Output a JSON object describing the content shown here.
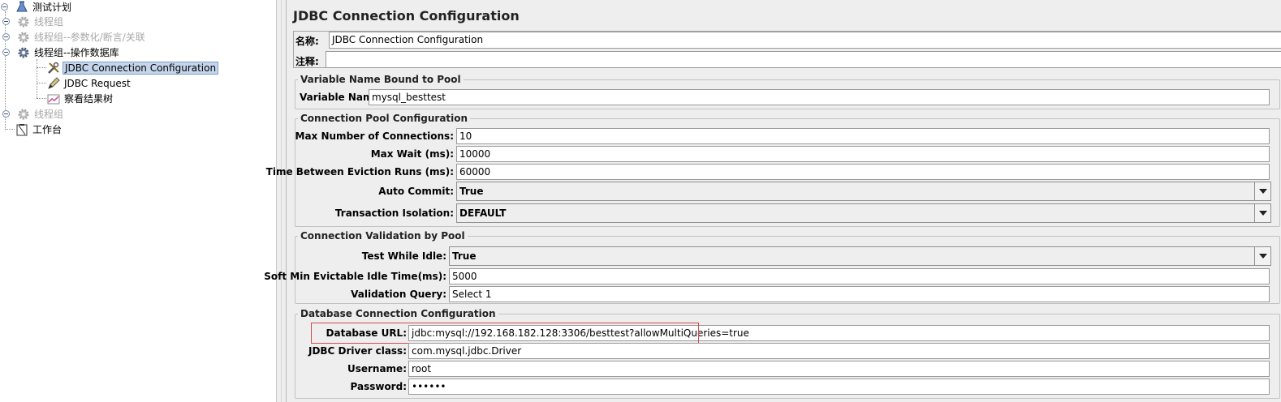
{
  "tree": {
    "root": {
      "label": "测试计划",
      "icon": "flask-icon"
    },
    "items": [
      {
        "label": "线程组",
        "icon": "gear-icon",
        "disabled": true
      },
      {
        "label": "线程组--参数化/断言/关联",
        "icon": "gear-icon",
        "disabled": true
      },
      {
        "label": "线程组--操作数据库",
        "icon": "gear-icon",
        "disabled": false
      },
      {
        "label": "JDBC Connection Configuration",
        "icon": "wrench-icon",
        "selected": true
      },
      {
        "label": "JDBC Request",
        "icon": "pencil-icon"
      },
      {
        "label": "察看结果树",
        "icon": "chart-icon"
      },
      {
        "label": "线程组",
        "icon": "gear-icon",
        "disabled": true
      }
    ],
    "workbench": {
      "label": "工作台",
      "icon": "clipboard-icon"
    }
  },
  "config": {
    "title": "JDBC Connection Configuration",
    "name_label": "名称:",
    "name_value": "JDBC Connection Configuration",
    "comment_label": "注释:",
    "comment_value": "",
    "variable_group": {
      "legend": "Variable Name Bound to Pool",
      "variable_name_label": "Variable Name:",
      "variable_name_value": "mysql_besttest"
    },
    "pool_group": {
      "legend": "Connection Pool Configuration",
      "max_connections_label": "Max Number of Connections:",
      "max_connections_value": "10",
      "max_wait_label": "Max Wait (ms):",
      "max_wait_value": "10000",
      "eviction_label": "Time Between Eviction Runs (ms):",
      "eviction_value": "60000",
      "auto_commit_label": "Auto Commit:",
      "auto_commit_value": "True",
      "isolation_label": "Transaction Isolation:",
      "isolation_value": "DEFAULT"
    },
    "validation_group": {
      "legend": "Connection Validation by Pool",
      "test_idle_label": "Test While Idle:",
      "test_idle_value": "True",
      "soft_min_label": "Soft Min Evictable Idle Time(ms):",
      "soft_min_value": "5000",
      "query_label": "Validation Query:",
      "query_value": "Select 1"
    },
    "db_group": {
      "legend": "Database Connection Configuration",
      "url_label": "Database URL:",
      "url_value": "jdbc:mysql://192.168.182.128:3306/besttest?allowMultiQueries=true",
      "driver_label": "JDBC Driver class:",
      "driver_value": "com.mysql.jdbc.Driver",
      "username_label": "Username:",
      "username_value": "root",
      "password_label": "Password:",
      "password_value": "••••••"
    }
  },
  "colors": {
    "highlight_border": "#d04a4a",
    "selection_bg": "#c5d6ec",
    "panel_bg": "#eeeeee"
  }
}
